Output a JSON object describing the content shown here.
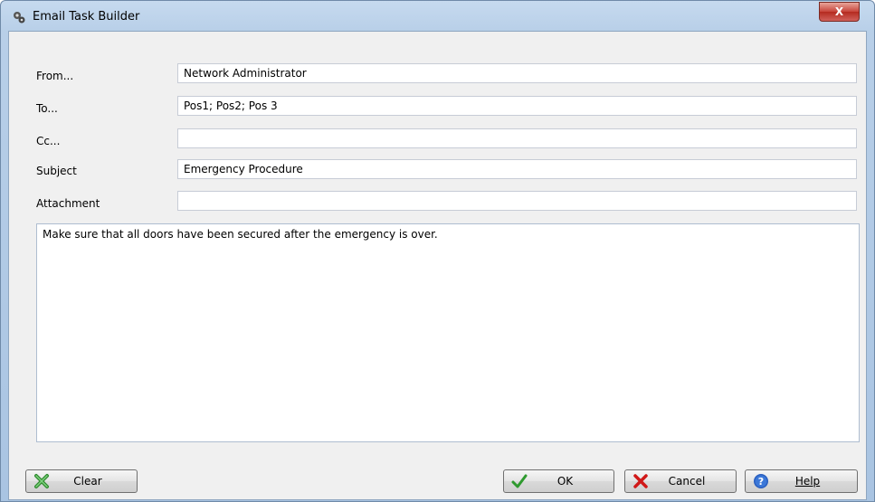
{
  "window": {
    "title": "Email Task Builder",
    "close_label": "X"
  },
  "fields": [
    {
      "label": "From...",
      "value": "Network Administrator"
    },
    {
      "label": "To...",
      "value": "Pos1; Pos2; Pos 3"
    },
    {
      "label": "Cc...",
      "value": ""
    },
    {
      "label": "Subject",
      "value": "Emergency Procedure"
    },
    {
      "label": "Attachment",
      "value": ""
    }
  ],
  "message_body": "Make sure that all doors have been secured after the emergency is over.",
  "buttons": {
    "clear": "Clear",
    "ok": "OK",
    "cancel": "Cancel",
    "help": "Help"
  },
  "icons": {
    "app": "gear-icon",
    "clear": "green-x-icon",
    "ok": "checkmark-icon",
    "cancel": "red-x-icon",
    "help": "question-icon"
  }
}
